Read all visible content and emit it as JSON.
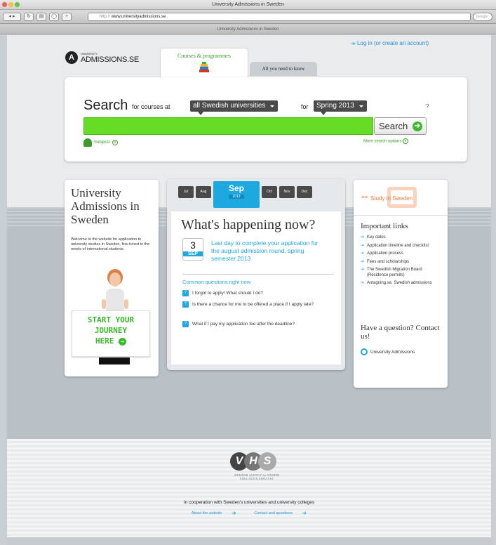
{
  "browser": {
    "window_title": "University Admissions in Sweden",
    "url_prefix": "http://",
    "url": "www.universityadmissions.se",
    "tab_title": "University Admissions in Sweden",
    "search_placeholder": "Google"
  },
  "header": {
    "logo_small": "UNIVERSITY",
    "logo_text": "ADMISSIONS.SE",
    "login_link": "Log in (or create an account)",
    "tabs": [
      {
        "label": "Courses & programmes"
      },
      {
        "label": "All you need to know"
      }
    ]
  },
  "search": {
    "title": "Search",
    "for_courses_at": "for courses at",
    "university_select": "all Swedish universities",
    "for": "for",
    "term_select": "Spring 2013",
    "help": "?",
    "button": "Search",
    "subjects": "Subjects",
    "more_options": "More search options"
  },
  "left_card": {
    "title": "University Admissions in Sweden",
    "text": "Welcome to the website for application to university studies in Sweden, fine-tuned to the needs of international students.",
    "sign_line1": "START YOUR",
    "sign_line2": "JOURNEY",
    "sign_line3": "HERE"
  },
  "timeline": {
    "months": [
      "Jul",
      "Aug"
    ],
    "months_after": [
      "Oct",
      "Nov",
      "Dec"
    ],
    "active_month": "Sep",
    "active_year": "2013"
  },
  "happening": {
    "title": "What's happening now?",
    "cal_day": "3",
    "cal_month": "SEP",
    "deadline_text": "Last day to complete your application for the august admission round, spring semester 2013",
    "common_title": "Common questions right now",
    "questions": [
      "I forgot to apply! What should I do?",
      "Is there a chance for me to be offered a place if I apply late?",
      "What if I pay my application fee after the deadline?"
    ]
  },
  "right_card": {
    "study_label": "Study in Sweden",
    "important_links_title": "Important links",
    "links": [
      "Key dates",
      "Application timeline and checklist",
      "Application process",
      "Fees and scholarships",
      "The Swedish Migration Board (Residence permits)",
      "Antagning.se, Swedish admissions"
    ],
    "question_title": "Have a question? Contact us!",
    "contact_link": "University Admissions"
  },
  "footer": {
    "agency": "SWEDISH AGENCY for HIGHER EDUCATION SERVICES",
    "cooperation": "In cooperation with Sweden's universities and university colleges",
    "about_link": "About the website",
    "contact_link": "Contact and questions"
  },
  "colors": {
    "accent_blue": "#1ea8e0",
    "accent_green": "#66dd22",
    "orange": "#f07a3c"
  }
}
